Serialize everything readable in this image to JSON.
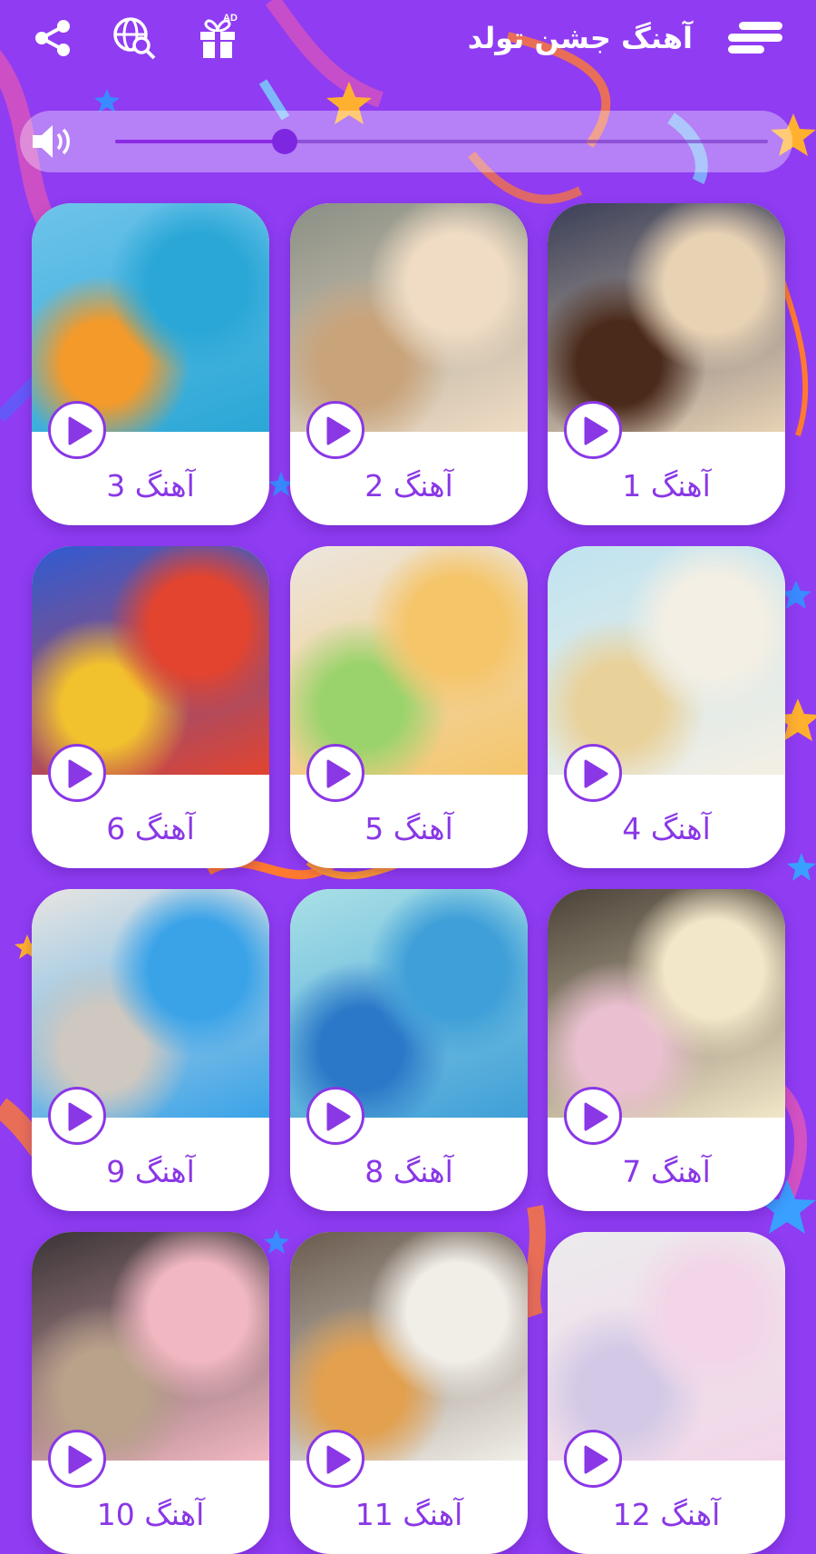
{
  "header": {
    "title": "آهنگ جشن تولد",
    "ad_badge": "AD",
    "icons": [
      "menu-icon",
      "gift-icon",
      "globe-search-icon",
      "share-icon"
    ]
  },
  "player": {
    "volume": 0.26,
    "icon": "speaker-icon"
  },
  "colors": {
    "background": "#8f3cf2",
    "accent": "#8a37e6",
    "card": "#ffffff"
  },
  "songs": [
    {
      "label": "آهنگ 1",
      "thumb": "cake-with-4-candle",
      "colors": [
        "#3a3f58",
        "#e8d2b4",
        "#4a2a1a"
      ]
    },
    {
      "label": "آهنگ 2",
      "thumb": "kids-blowing-candles",
      "colors": [
        "#8a8f85",
        "#f0dcc4",
        "#c9a37a"
      ]
    },
    {
      "label": "آهنگ 3",
      "thumb": "man-with-balloons",
      "colors": [
        "#6ec3ea",
        "#2aa7d6",
        "#f39a2a"
      ]
    },
    {
      "label": "آهنگ 4",
      "thumb": "birthday-cake-candles",
      "colors": [
        "#bfe3f0",
        "#f4efe4",
        "#e9d19a"
      ]
    },
    {
      "label": "آهنگ 5",
      "thumb": "gift-bag-balloons",
      "colors": [
        "#ece6df",
        "#f5c56a",
        "#9ad36c"
      ]
    },
    {
      "label": "آهنگ 6",
      "thumb": "happy-birthday-balloons",
      "colors": [
        "#2f5bd3",
        "#e2442f",
        "#f2c12e"
      ]
    },
    {
      "label": "آهنگ 7",
      "thumb": "happy-birthday-cake",
      "colors": [
        "#4b4238",
        "#f3e7c9",
        "#eac0d0"
      ]
    },
    {
      "label": "آهنگ 8",
      "thumb": "blue-cupcake",
      "colors": [
        "#a9e0e6",
        "#3f9fd8",
        "#2c78c8"
      ]
    },
    {
      "label": "آهنگ 9",
      "thumb": "blue-balloons",
      "colors": [
        "#e8e5e2",
        "#3aa3e8",
        "#cfc8c0"
      ]
    },
    {
      "label": "آهنگ 12",
      "thumb": "white-curtain-cupcakes",
      "colors": [
        "#ecebed",
        "#f2d6e8",
        "#d3c9e6"
      ]
    },
    {
      "label": "آهنگ 11",
      "thumb": "sparkler-cake",
      "colors": [
        "#6a5b4e",
        "#f1eee8",
        "#e3a04e"
      ]
    },
    {
      "label": "آهنگ 10",
      "thumb": "women-celebrating",
      "colors": [
        "#3a3436",
        "#f2b8c2",
        "#b8a28a"
      ]
    }
  ]
}
